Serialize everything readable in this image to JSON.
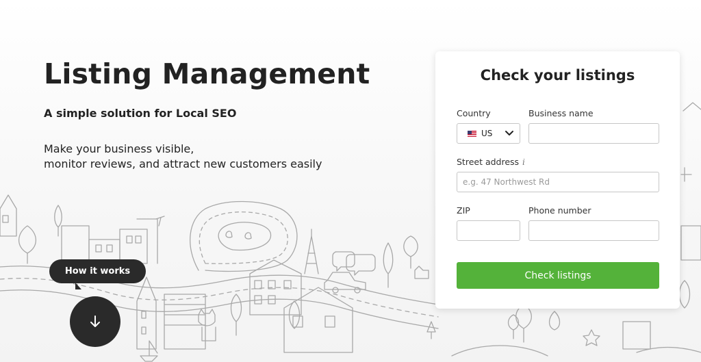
{
  "hero": {
    "title": "Listing Management",
    "subtitle": "A simple solution for Local SEO",
    "description_lines": [
      "Make your business visible,",
      "monitor reviews, and attract new customers easily"
    ]
  },
  "how_it_works": {
    "label": "How it works",
    "icon": "arrow-down-icon"
  },
  "form": {
    "title": "Check your listings",
    "country": {
      "label": "Country",
      "value": "US",
      "flag_icon": "us-flag-icon"
    },
    "business_name": {
      "label": "Business name",
      "value": "",
      "placeholder": ""
    },
    "street_address": {
      "label": "Street address",
      "info_icon": "info-icon",
      "value": "",
      "placeholder": "e.g. 47 Northwest Rd"
    },
    "zip": {
      "label": "ZIP",
      "value": "",
      "placeholder": ""
    },
    "phone": {
      "label": "Phone number",
      "value": "",
      "placeholder": ""
    },
    "submit_label": "Check listings"
  },
  "colors": {
    "accent_green": "#54b23a",
    "dark": "#2a2a2a",
    "illustration_stroke": "#9a9a9a"
  }
}
